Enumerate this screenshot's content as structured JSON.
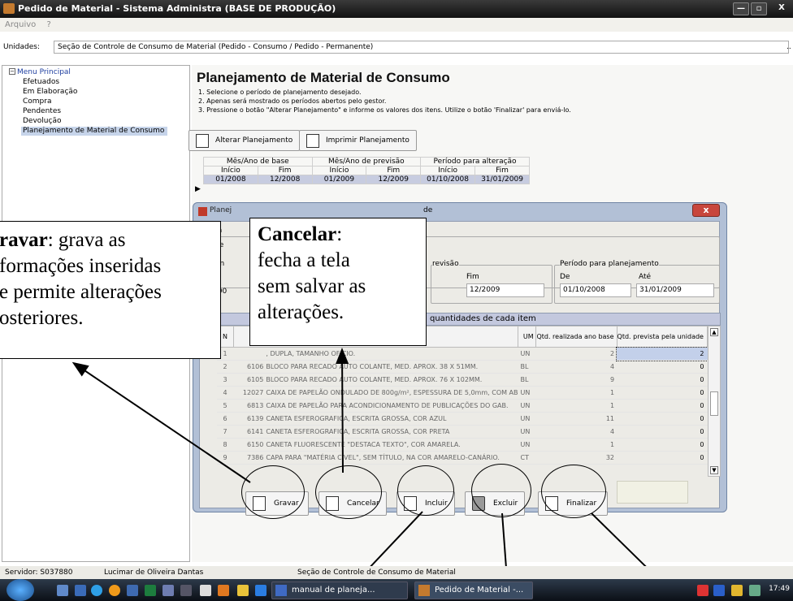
{
  "window": {
    "title": "Pedido de Material - Sistema Administra (BASE DE PRODUÇÃO)",
    "min": "—",
    "max": "▫",
    "close": "X"
  },
  "menu": {
    "items": [
      "Arquivo",
      "?"
    ]
  },
  "unidades": {
    "label": "Unidades:",
    "value": "Seção de Controle de Consumo de Material (Pedido - Consumo / Pedido - Permanente)",
    "more": ".."
  },
  "sidebar": {
    "root": "Menu Principal",
    "items": [
      "Efetuados",
      "Em Elaboração",
      "Compra",
      "Pendentes",
      "Devolução",
      "Planejamento de Material de Consumo"
    ]
  },
  "main": {
    "title": "Planejamento de Material de Consumo",
    "steps": [
      "1. Selecione o período de planejamento desejado.",
      "2. Apenas será mostrado os períodos abertos pelo gestor.",
      "3. Pressione o botão \"Alterar Planejamento\" e informe os valores dos itens. Utilize o botão 'Finalizar' para enviá-lo."
    ],
    "btn_alterar": "Alterar Planejamento",
    "btn_imprimir": "Imprimir Planejamento"
  },
  "period_grid": {
    "groups": [
      "Mês/Ano de base",
      "Mês/Ano de previsão",
      "Período para alteração"
    ],
    "subheaders": [
      "Início",
      "Fim",
      "Início",
      "Fim",
      "Início",
      "Fim"
    ],
    "row": [
      "01/2008",
      "12/2008",
      "01/2009",
      "12/2009",
      "01/10/2008",
      "31/01/2009"
    ],
    "indicator": "▶"
  },
  "dialog": {
    "title": "Planejamento de Material de Consumo - Unidade",
    "title_visible": "Planej",
    "title_visible2": "de",
    "close": "x",
    "frag_da": "da",
    "frag_de": "de",
    "frag_van": "/an",
    "frag_200": "200",
    "previsao_label": "revisão",
    "fim_label": "Fim",
    "fim_value": "12/2009",
    "periodo_label": "Período para planejamento",
    "de_label": "De",
    "ate_label": "Até",
    "de_value": "01/10/2008",
    "ate_value": "31/01/2009",
    "band_header": "quantidades de cada item",
    "col_n": "N",
    "col_um": "UM",
    "col_realizada": "Qtd. realizada ano base",
    "col_prevista": "Qtd. prevista pela unidade",
    "items": [
      {
        "n": "1",
        "code": "",
        "desc": ", DUPLA, TAMANHO OFICIO.",
        "um": "UN",
        "real": "2",
        "prev": "2"
      },
      {
        "n": "2",
        "code": "6106",
        "desc": "BLOCO PARA RECADO AUTO COLANTE, MED. APROX. 38 X 51MM.",
        "um": "BL",
        "real": "4",
        "prev": "0"
      },
      {
        "n": "3",
        "code": "6105",
        "desc": "BLOCO PARA RECADO AUTO COLANTE, MED. APROX. 76 X 102MM.",
        "um": "BL",
        "real": "9",
        "prev": "0"
      },
      {
        "n": "4",
        "code": "12027",
        "desc": "CAIXA DE PAPELÃO ONDULADO DE 800g/m², ESPESSURA DE 5,0mm, COM AB",
        "um": "UN",
        "real": "1",
        "prev": "0"
      },
      {
        "n": "5",
        "code": "6813",
        "desc": "CAIXA DE PAPELÃO PARA ACONDICIONAMENTO DE PUBLICAÇÕES DO GAB.",
        "um": "UN",
        "real": "1",
        "prev": "0"
      },
      {
        "n": "6",
        "code": "6139",
        "desc": "CANETA ESFEROGRAFICA, ESCRITA GROSSA, COR AZUL",
        "um": "UN",
        "real": "11",
        "prev": "0"
      },
      {
        "n": "7",
        "code": "6141",
        "desc": "CANETA ESFEROGRAFICA, ESCRITA GROSSA, COR PRETA",
        "um": "UN",
        "real": "4",
        "prev": "0"
      },
      {
        "n": "8",
        "code": "6150",
        "desc": "CANETA FLUORESCENTE \"DESTACA TEXTO\", COR AMARELA.",
        "um": "UN",
        "real": "1",
        "prev": "0"
      },
      {
        "n": "9",
        "code": "7386",
        "desc": "CAPA PARA \"MATÉRIA CÍVEL\", SEM TÍTULO, NA COR AMARELO-CANÁRIO.",
        "um": "CT",
        "real": "32",
        "prev": "0"
      }
    ],
    "buttons": {
      "gravar": "Gravar",
      "cancelar": "Cancelar",
      "incluir": "Incluir",
      "excluir": "Excluir",
      "finalizar": "Finalizar"
    }
  },
  "annotations": {
    "gravar_bold": "ravar",
    "gravar_lines": [
      ": grava as",
      "formações inseridas",
      "e permite alterações",
      "osteriores."
    ],
    "cancelar_bold": "Cancelar",
    "cancelar_lines": [
      ":",
      "fecha a tela",
      "sem salvar as",
      "alterações."
    ]
  },
  "statusbar": {
    "servidor": "Servidor: S037880",
    "user": "Lucimar de Oliveira Dantas",
    "secao": "Seção de Controle de Consumo de Material"
  },
  "taskbar": {
    "tasks": [
      "manual de planeja...",
      "Pedido de Material -..."
    ],
    "clock": "17:49"
  }
}
